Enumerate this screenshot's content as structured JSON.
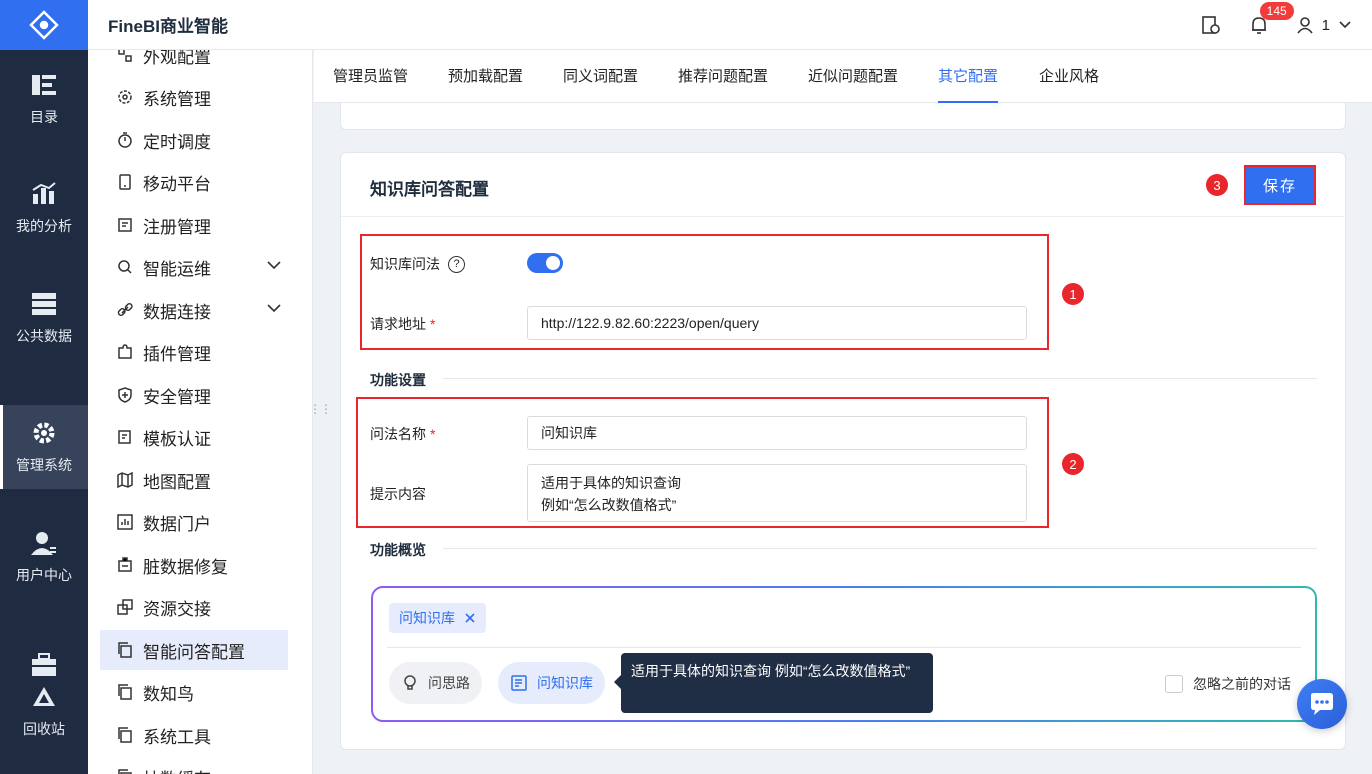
{
  "app": {
    "brand": "FineBI商业智能",
    "notification_count": "145",
    "user_name": "1"
  },
  "rail": {
    "items": [
      {
        "label": "目录",
        "icon": "catalog-icon"
      },
      {
        "label": "我的分析",
        "icon": "analysis-icon"
      },
      {
        "label": "公共数据",
        "icon": "database-icon"
      },
      {
        "label": "管理系统",
        "icon": "gear-icon",
        "active": true
      },
      {
        "label": "用户中心",
        "icon": "user-icon"
      },
      {
        "label": "回收站",
        "icon": "recycle-icon"
      }
    ]
  },
  "subnav": {
    "items": [
      {
        "label": "外观配置"
      },
      {
        "label": "系统管理"
      },
      {
        "label": "定时调度"
      },
      {
        "label": "移动平台"
      },
      {
        "label": "注册管理"
      },
      {
        "label": "智能运维",
        "expandable": true
      },
      {
        "label": "数据连接",
        "expandable": true
      },
      {
        "label": "插件管理"
      },
      {
        "label": "安全管理"
      },
      {
        "label": "模板认证"
      },
      {
        "label": "地图配置"
      },
      {
        "label": "数据门户"
      },
      {
        "label": "脏数据修复"
      },
      {
        "label": "资源交接"
      },
      {
        "label": "智能问答配置",
        "active": true
      },
      {
        "label": "数知鸟"
      },
      {
        "label": "系统工具"
      },
      {
        "label": "抽数缓存"
      }
    ]
  },
  "tabs": [
    {
      "label": "管理员监管"
    },
    {
      "label": "预加载配置"
    },
    {
      "label": "同义词配置"
    },
    {
      "label": "推荐问题配置"
    },
    {
      "label": "近似问题配置"
    },
    {
      "label": "其它配置",
      "active": true
    },
    {
      "label": "企业风格"
    }
  ],
  "card": {
    "title": "知识库问答配置",
    "save_label": "保存",
    "markers": [
      "1",
      "2",
      "3"
    ],
    "kb_toggle_label": "知识库问法",
    "kb_toggle_on": true,
    "url_label": "请求地址",
    "url_value": "http://122.9.82.60:2223/open/query",
    "func_section": "功能设置",
    "name_label": "问法名称",
    "name_value": "问知识库",
    "hint_label": "提示内容",
    "hint_line1": "适用于具体的知识查询",
    "hint_line2": "例如“怎么改数值格式”",
    "overview_section": "功能概览"
  },
  "preview": {
    "chip_label": "问知识库",
    "pill_think": "问思路",
    "pill_kb": "问知识库",
    "ignore_label": "忽略之前的对话",
    "ignore_checked": false,
    "tooltip": "适用于具体的知识查询 例如“怎么改数值格式”"
  },
  "colors": {
    "accent": "#2f6ff0",
    "rail_bg": "#1e2b40",
    "highlight_red": "#e8262b"
  }
}
